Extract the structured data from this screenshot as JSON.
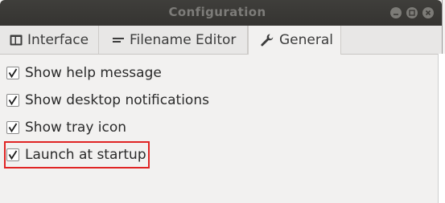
{
  "window": {
    "title": "Configuration"
  },
  "tabs": [
    {
      "label": "Interface",
      "icon": "window-icon",
      "active": false
    },
    {
      "label": "Filename Editor",
      "icon": "text-lines-icon",
      "active": false
    },
    {
      "label": "General",
      "icon": "wrench-icon",
      "active": true
    }
  ],
  "options": [
    {
      "label": "Show help message",
      "checked": true
    },
    {
      "label": "Show desktop notifications",
      "checked": true
    },
    {
      "label": "Show tray icon",
      "checked": true
    },
    {
      "label": "Launch at startup",
      "checked": true,
      "highlighted": true
    }
  ],
  "colors": {
    "highlight": "#e02424",
    "titlebar": "#3f3e3b",
    "background": "#f2f1f0"
  }
}
